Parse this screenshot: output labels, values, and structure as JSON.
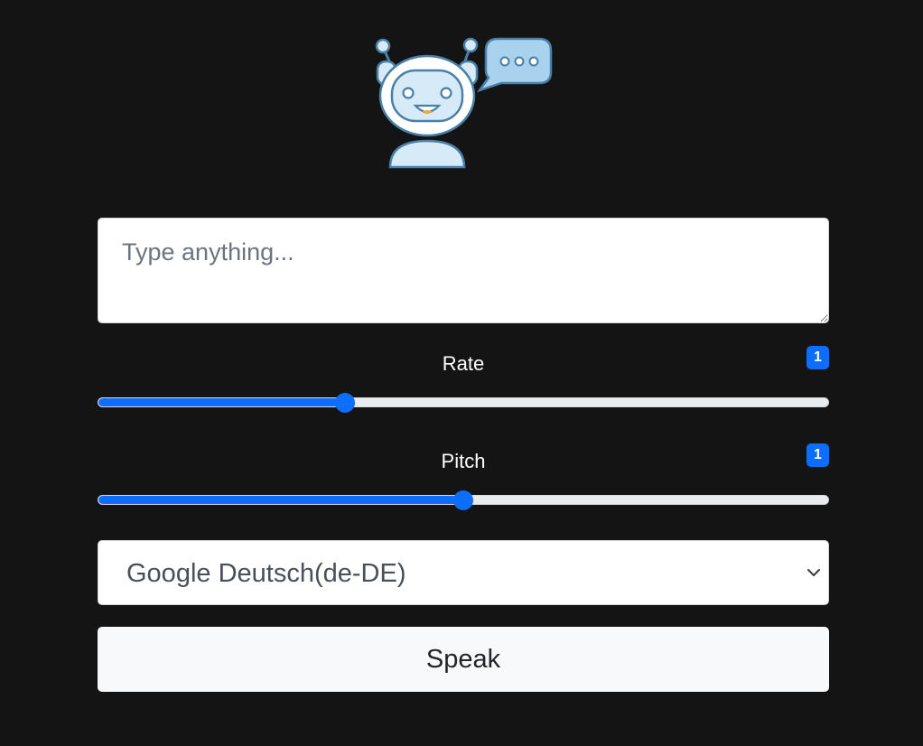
{
  "text_input": {
    "placeholder": "Type anything...",
    "value": ""
  },
  "rate": {
    "label": "Rate",
    "value_display": "1",
    "level_fraction": 0.338
  },
  "pitch": {
    "label": "Pitch",
    "value_display": "1",
    "level_fraction": 0.5
  },
  "voice": {
    "selected": "Google Deutsch(de-DE)"
  },
  "speak_button": {
    "label": "Speak"
  },
  "colors": {
    "background": "#141414",
    "accent": "#0d6efd",
    "robot_outline": "#4a7fa8",
    "robot_fill": "#d7eaf7"
  },
  "icons": {
    "logo": "robot-with-speech-bubble-icon",
    "select_arrow": "chevron-down-icon"
  }
}
